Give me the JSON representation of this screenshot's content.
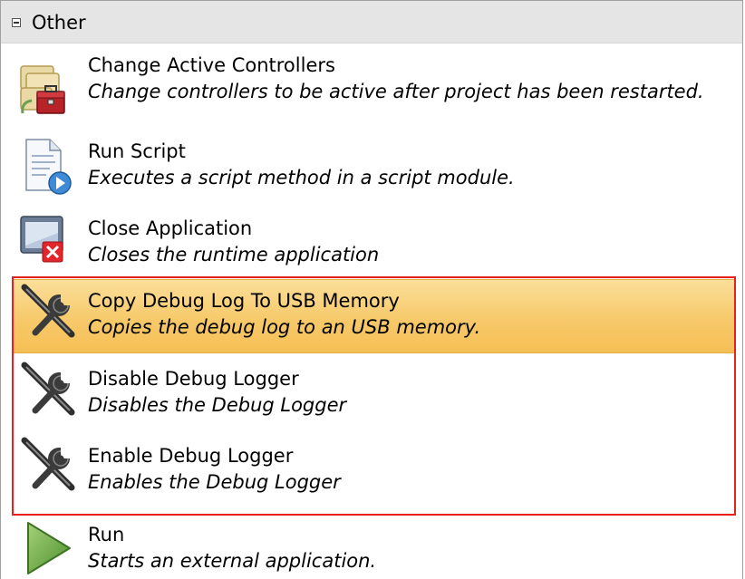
{
  "group": {
    "label": "Other",
    "expanded": true
  },
  "items": [
    {
      "title": "Change Active Controllers",
      "description": "Change controllers to be active after project has been restarted.",
      "icon": "controllers-toolbox-icon",
      "selected": false
    },
    {
      "title": "Run Script",
      "description": "Executes a script method in a script module.",
      "icon": "script-document-icon",
      "selected": false
    },
    {
      "title": "Close Application",
      "description": "Closes the runtime application",
      "icon": "close-window-icon",
      "selected": false
    },
    {
      "title": "Copy Debug Log To USB Memory",
      "description": "Copies the debug log to an USB memory.",
      "icon": "wrench-screwdriver-icon",
      "selected": true
    },
    {
      "title": "Disable Debug Logger",
      "description": "Disables the Debug Logger",
      "icon": "wrench-screwdriver-icon",
      "selected": false
    },
    {
      "title": "Enable Debug Logger",
      "description": "Enables the Debug Logger",
      "icon": "wrench-screwdriver-icon",
      "selected": false
    },
    {
      "title": "Run",
      "description": "Starts an external application.",
      "icon": "play-triangle-icon",
      "selected": false
    }
  ],
  "colors": {
    "selection": "#f7c96a",
    "highlight_border": "#e8201c",
    "header_bg": "#e5e5e5"
  }
}
